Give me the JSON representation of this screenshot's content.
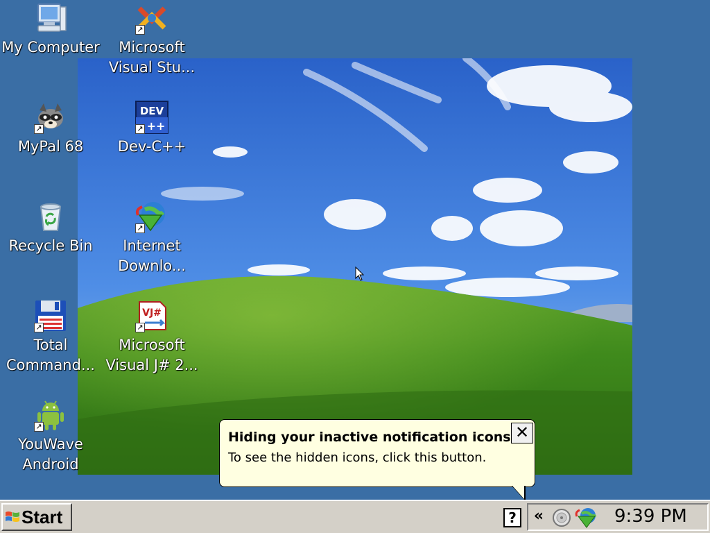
{
  "desktop": {
    "icons": [
      {
        "label": "My Computer",
        "icon": "my-computer-icon",
        "shortcut": false
      },
      {
        "label": "Microsoft\nVisual Stu...",
        "icon": "visual-studio-icon",
        "shortcut": true
      },
      {
        "label": "MyPal 68",
        "icon": "mypal-raccoon-icon",
        "shortcut": true
      },
      {
        "label": "Dev-C++",
        "icon": "dev-cpp-icon",
        "shortcut": true
      },
      {
        "label": "Recycle Bin",
        "icon": "recycle-bin-icon",
        "shortcut": false
      },
      {
        "label": "Internet\nDownlo...",
        "icon": "internet-download-manager-icon",
        "shortcut": true
      },
      {
        "label": "Total\nCommand...",
        "icon": "total-commander-icon",
        "shortcut": true
      },
      {
        "label": "Microsoft\nVisual J# 2...",
        "icon": "visual-jsharp-icon",
        "shortcut": true
      },
      {
        "label": "YouWave\nAndroid",
        "icon": "android-icon",
        "shortcut": true
      }
    ],
    "dev_icon_text": "DEV",
    "vj_icon_text": "VJ#"
  },
  "balloon": {
    "title": "Hiding your inactive notification icons...",
    "text": "To see the hidden icons, click this button.",
    "close_glyph": "✕"
  },
  "taskbar": {
    "start_label": "Start",
    "help_glyph": "?",
    "tray_expand_glyph": "«",
    "clock": "9:39 PM"
  },
  "colors": {
    "desktop": "#3a6ea5",
    "taskbar": "#d4d0c8",
    "balloon": "#ffffe1"
  }
}
